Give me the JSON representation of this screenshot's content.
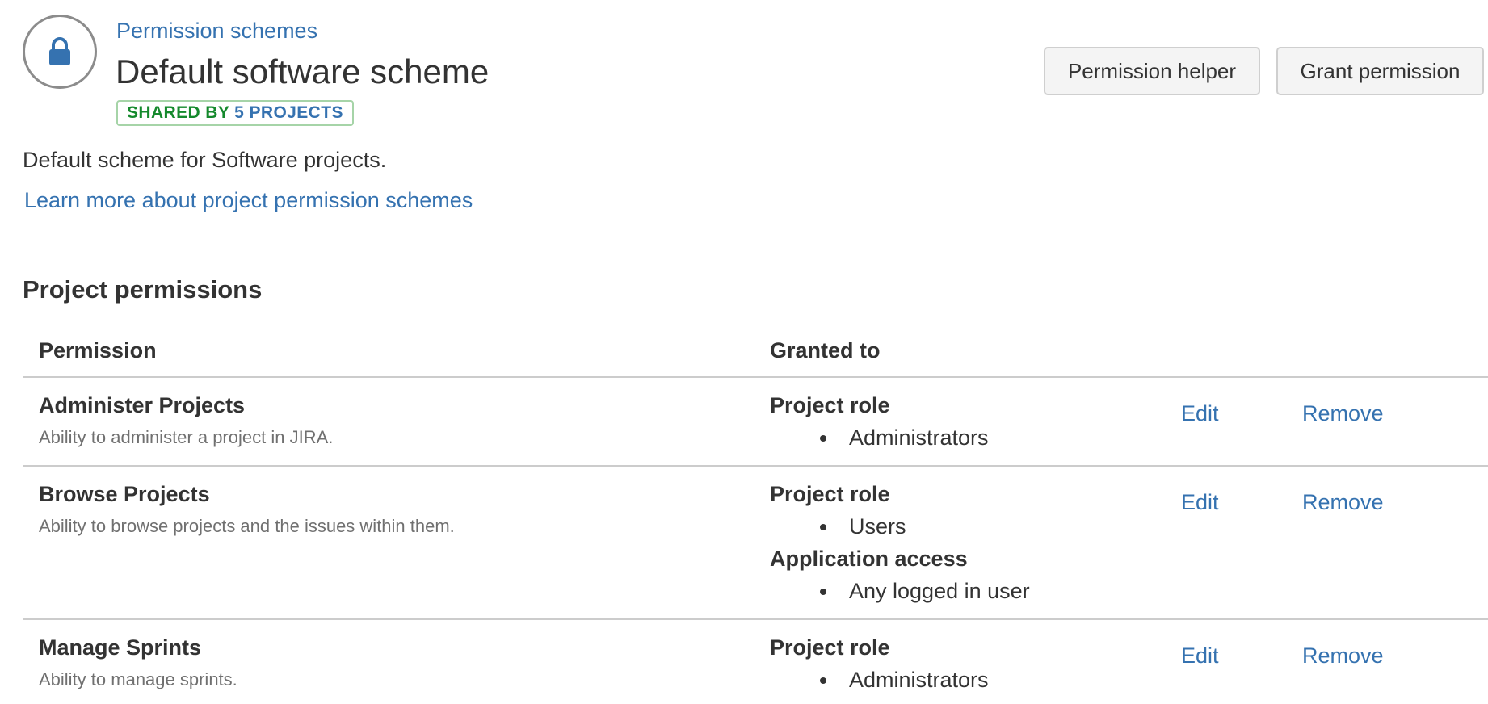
{
  "header": {
    "breadcrumb": "Permission schemes",
    "title": "Default software scheme",
    "badge": {
      "shared_text": "SHARED BY",
      "projects_text": "5 PROJECTS"
    },
    "avatar_icon": "lock-icon"
  },
  "actions": {
    "permission_helper": "Permission helper",
    "grant_permission": "Grant permission"
  },
  "description": "Default scheme for Software projects.",
  "learn_more": "Learn more about project permission schemes",
  "section": {
    "title": "Project permissions"
  },
  "table": {
    "columns": {
      "permission": "Permission",
      "granted_to": "Granted to"
    },
    "rows": [
      {
        "name": "Administer Projects",
        "description": "Ability to administer a project in JIRA.",
        "grants": [
          {
            "type": "Project role",
            "items": [
              "Administrators"
            ]
          }
        ],
        "edit": "Edit",
        "remove": "Remove"
      },
      {
        "name": "Browse Projects",
        "description": "Ability to browse projects and the issues within them.",
        "grants": [
          {
            "type": "Project role",
            "items": [
              "Users"
            ]
          },
          {
            "type": "Application access",
            "items": [
              "Any logged in user"
            ]
          }
        ],
        "edit": "Edit",
        "remove": "Remove"
      },
      {
        "name": "Manage Sprints",
        "description": "Ability to manage sprints.",
        "grants": [
          {
            "type": "Project role",
            "items": [
              "Administrators"
            ]
          }
        ],
        "edit": "Edit",
        "remove": "Remove"
      }
    ]
  },
  "colors": {
    "link": "#3572b0",
    "shared_green": "#14892c",
    "badge_border": "#a6d4a8",
    "text": "#333333",
    "muted_text": "#707070",
    "lock": "#3572b0"
  }
}
